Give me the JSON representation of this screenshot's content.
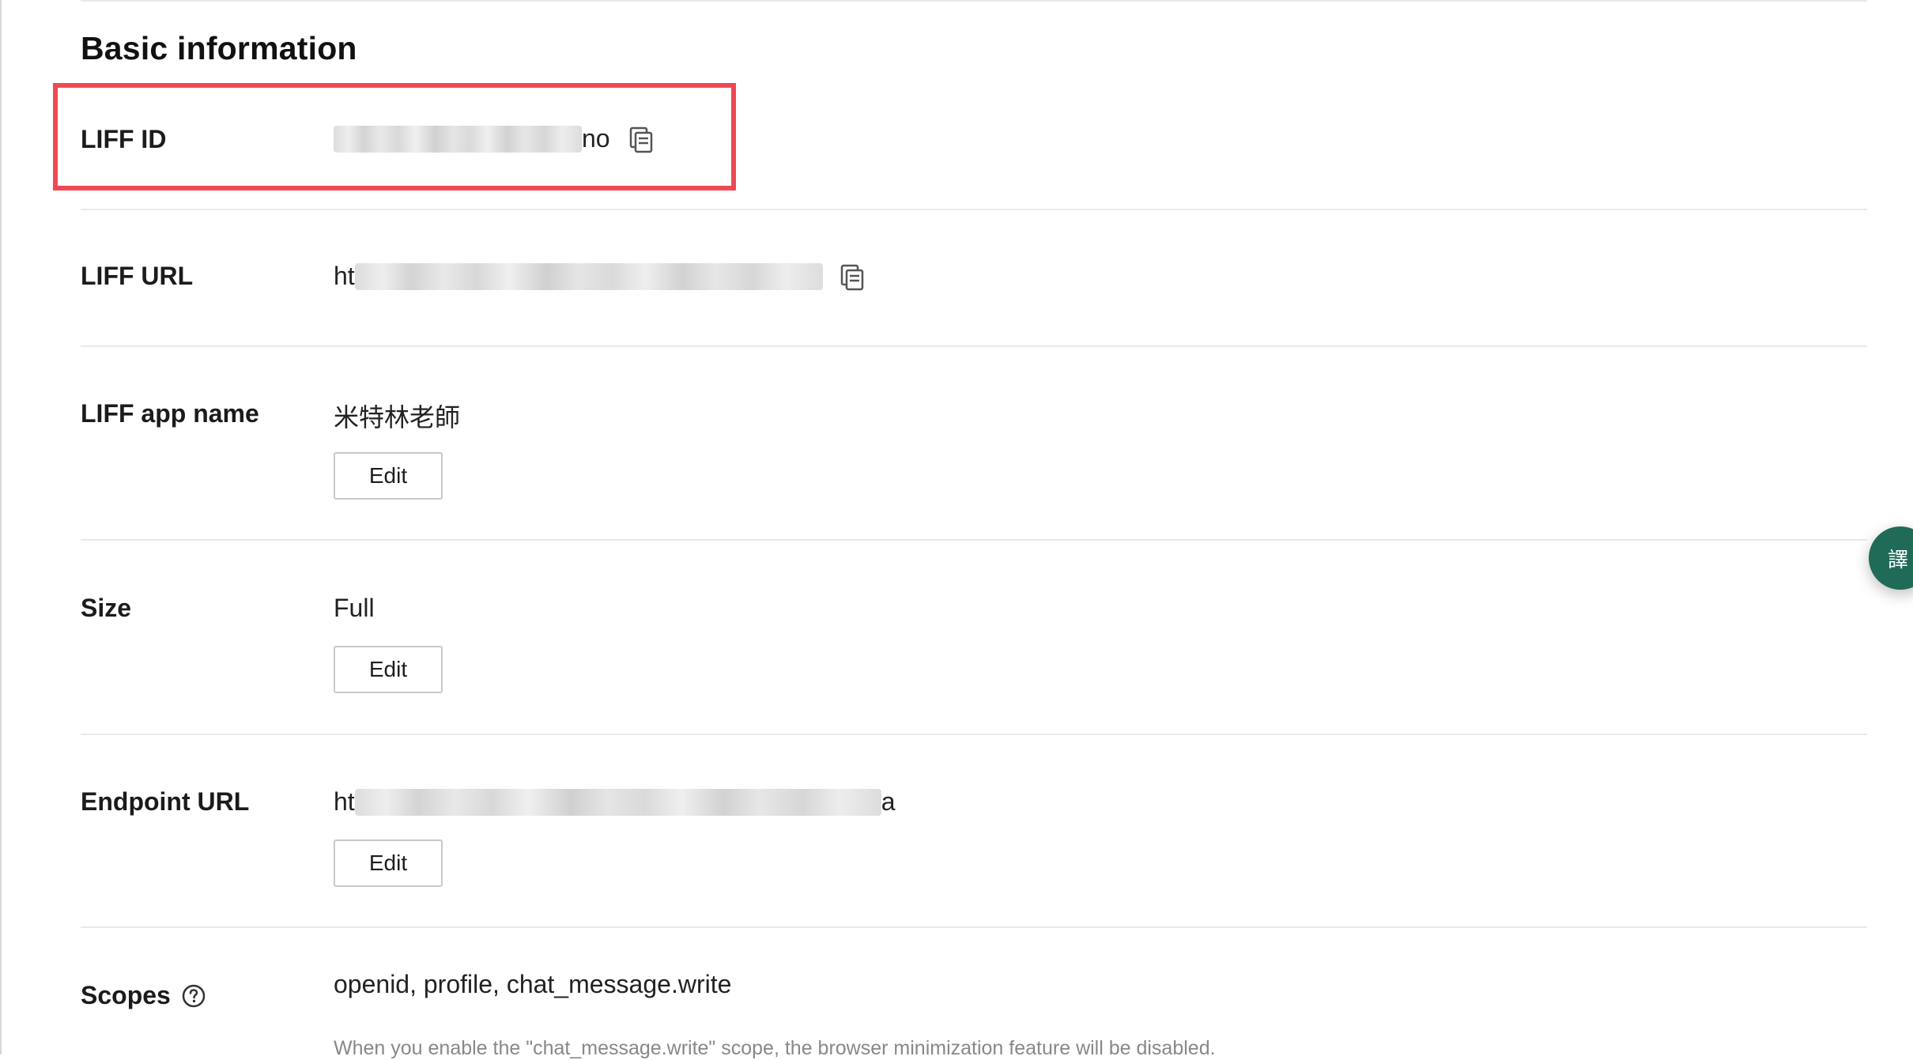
{
  "section": {
    "title": "Basic information"
  },
  "rows": {
    "liff_id": {
      "label": "LIFF ID",
      "value_suffix": "no"
    },
    "liff_url": {
      "label": "LIFF URL",
      "value_prefix": "ht"
    },
    "app_name": {
      "label": "LIFF app name",
      "value": "米特林老師",
      "edit_label": "Edit"
    },
    "size": {
      "label": "Size",
      "value": "Full",
      "edit_label": "Edit"
    },
    "endpoint_url": {
      "label": "Endpoint URL",
      "value_prefix": "ht",
      "value_suffix": "a",
      "edit_label": "Edit"
    },
    "scopes": {
      "label": "Scopes",
      "value": "openid, profile, chat_message.write",
      "note": "When you enable the \"chat_message.write\" scope, the browser minimization feature will be disabled."
    }
  },
  "floating": {
    "translate_label": "譯"
  },
  "colors": {
    "highlight": "#ee4a55",
    "translate_bg": "#1f6b57",
    "divider": "#e9e9e9"
  },
  "icons": {
    "copy": "copy-icon",
    "help": "question-circle-icon"
  }
}
